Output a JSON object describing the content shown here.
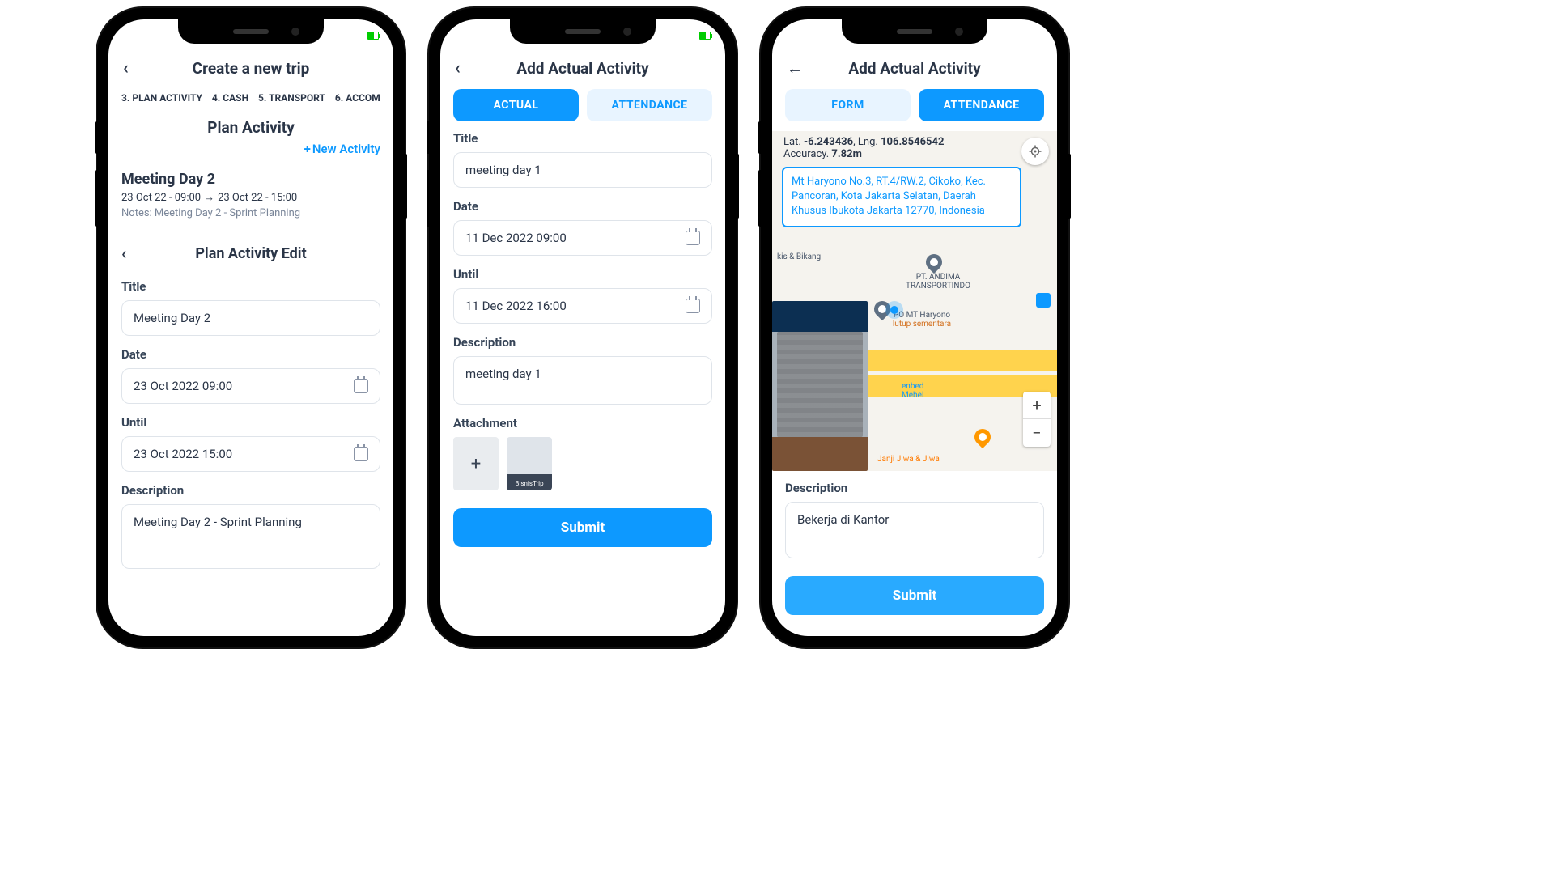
{
  "phone1": {
    "title": "Create a new trip",
    "steps": [
      "3. PLAN ACTIVITY",
      "4. CASH",
      "5. TRANSPORT",
      "6. ACCOM"
    ],
    "section": "Plan Activity",
    "new_activity": "New Activity",
    "meeting": {
      "title": "Meeting Day 2",
      "time_from": "23 Oct 22 - 09:00",
      "time_to": "23 Oct 22 - 15:00",
      "notes": "Notes: Meeting Day 2 - Sprint Planning"
    },
    "edit_title": "Plan Activity Edit",
    "form": {
      "title_label": "Title",
      "title_value": "Meeting Day 2",
      "date_label": "Date",
      "date_value": "23 Oct 2022 09:00",
      "until_label": "Until",
      "until_value": "23 Oct 2022 15:00",
      "desc_label": "Description",
      "desc_value": "Meeting Day 2 - Sprint Planning"
    }
  },
  "phone2": {
    "title": "Add Actual Activity",
    "tabs": {
      "actual": "ACTUAL",
      "attendance": "ATTENDANCE"
    },
    "form": {
      "title_label": "Title",
      "title_value": "meeting day 1",
      "date_label": "Date",
      "date_value": "11 Dec 2022 09:00",
      "until_label": "Until",
      "until_value": "11 Dec 2022 16:00",
      "desc_label": "Description",
      "desc_value": "meeting day 1",
      "attach_label": "Attachment",
      "attach_thumb": "BisnisTrip"
    },
    "submit": "Submit"
  },
  "phone3": {
    "title": "Add Actual Activity",
    "tabs": {
      "form": "FORM",
      "attendance": "ATTENDANCE"
    },
    "location": {
      "lat_label": "Lat.",
      "lat": "-6.243436",
      "lng_label": "Lng.",
      "lng": "106.8546542",
      "acc_label": "Accuracy.",
      "acc": "7.82m",
      "address": "Mt Haryono No.3, RT.4/RW.2, Cikoko, Kec. Pancoran, Kota Jakarta Selatan, Daerah Khusus Ibukota Jakarta 12770, Indonesia"
    },
    "map_labels": {
      "poi1": "kis & Bikang",
      "poi2": "PT. ANDIMA TRANSPORTINDO",
      "poi3": "PO MT Haryono",
      "poi3b": "lutup sementara",
      "poi4": "enbed",
      "poi4b": "Mebel",
      "poi5": "Janji Jiwa & Jiwa"
    },
    "desc_label": "Description",
    "desc_value": "Bekerja di Kantor",
    "submit": "Submit"
  }
}
